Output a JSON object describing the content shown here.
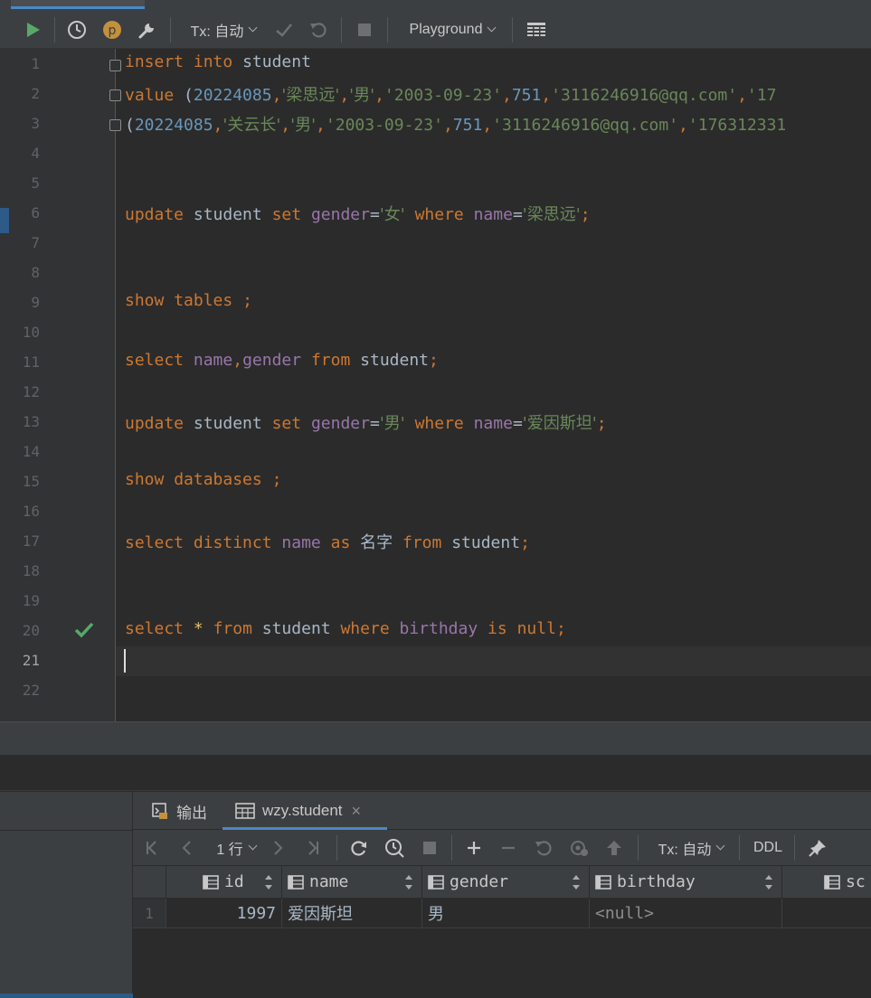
{
  "toolbar": {
    "tx_mode": "Tx: 自动",
    "playground": "Playground"
  },
  "editor": {
    "line_numbers": [
      "1",
      "2",
      "3",
      "4",
      "5",
      "6",
      "7",
      "8",
      "9",
      "10",
      "11",
      "12",
      "13",
      "14",
      "15",
      "16",
      "17",
      "18",
      "19",
      "20",
      "21",
      "22"
    ],
    "current_line": "21",
    "lines": {
      "l1": [
        "insert",
        " ",
        "into",
        " student"
      ],
      "l2": [
        "value",
        " (",
        "20224085",
        ",",
        "'梁思远'",
        ",",
        "'男'",
        ",",
        "'2003-09-23'",
        ",",
        "751",
        ",",
        "'3116246916@qq.com'",
        ",",
        "'17"
      ],
      "l3": [
        "(",
        "20224085",
        ",",
        "'关云长'",
        ",",
        "'男'",
        ",",
        "'2003-09-23'",
        ",",
        "751",
        ",",
        "'3116246916@qq.com'",
        ",",
        "'176312331"
      ],
      "l6": [
        "update",
        " student ",
        "set",
        " ",
        "gender",
        "=",
        "'女'",
        " ",
        "where",
        " ",
        "name",
        "=",
        "'梁思远'",
        ";"
      ],
      "l9": [
        "show",
        " ",
        "tables",
        " ;"
      ],
      "l11": [
        "select",
        " ",
        "name",
        ",",
        "gender",
        " ",
        "from",
        " student",
        ";"
      ],
      "l13": [
        "update",
        " student ",
        "set",
        " ",
        "gender",
        "=",
        "'男'",
        " ",
        "where",
        " ",
        "name",
        "=",
        "'爱因斯坦'",
        ";"
      ],
      "l15": [
        "show",
        " ",
        "databases",
        " ;"
      ],
      "l17": [
        "select",
        " ",
        "distinct",
        " ",
        "name",
        " ",
        "as",
        " ",
        "名字",
        " ",
        "from",
        " student",
        ";"
      ],
      "l20": [
        "select",
        " ",
        "*",
        " ",
        "from",
        " student ",
        "where",
        " ",
        "birthday",
        " ",
        "is",
        " ",
        "null",
        ";"
      ]
    }
  },
  "bottom_tabs": {
    "output": "输出",
    "table": "wzy.student"
  },
  "results_toolbar": {
    "rows": "1 行",
    "tx_mode": "Tx: 自动",
    "ddl": "DDL"
  },
  "grid": {
    "columns": [
      "id",
      "name",
      "gender",
      "birthday",
      "sc"
    ],
    "row_number": "1",
    "row": {
      "id": "1997",
      "name": "爱因斯坦",
      "gender": "男",
      "birthday": "<null>",
      "sc": "<"
    }
  },
  "colors": {
    "keyword": "#cc7832",
    "column": "#9876aa",
    "string": "#6a8759",
    "number": "#6897bb",
    "plain": "#a9b7c6",
    "run_green": "#59a869",
    "accent_blue": "#4a88c7"
  }
}
